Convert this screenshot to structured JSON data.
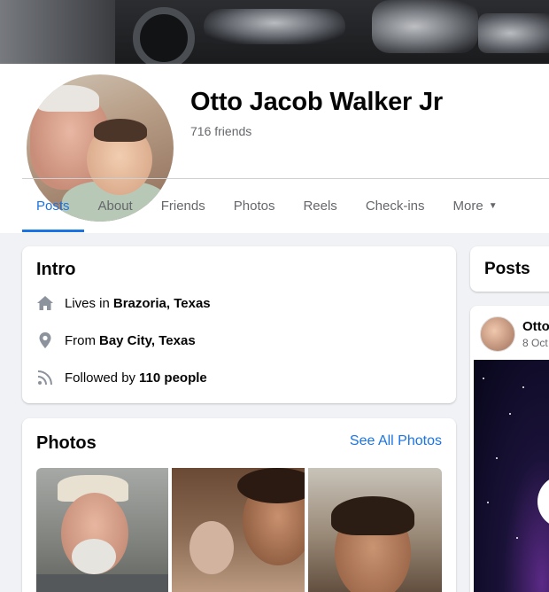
{
  "profile": {
    "name": "Otto Jacob Walker Jr",
    "friends": "716 friends"
  },
  "nav": {
    "tabs": [
      {
        "label": "Posts"
      },
      {
        "label": "About"
      },
      {
        "label": "Friends"
      },
      {
        "label": "Photos"
      },
      {
        "label": "Reels"
      },
      {
        "label": "Check-ins"
      },
      {
        "label": "More"
      }
    ],
    "more_caret": "▼"
  },
  "intro": {
    "title": "Intro",
    "lives_prefix": "Lives in",
    "lives_value": "Brazoria, Texas",
    "from_prefix": "From",
    "from_value": "Bay City, Texas",
    "followed_prefix": "Followed by",
    "followed_value": "110 people"
  },
  "photos": {
    "title": "Photos",
    "see_all": "See All Photos"
  },
  "posts": {
    "title": "Posts",
    "post_name": "Otto",
    "post_date": "8 Oct"
  },
  "icons": {
    "lives": "home-icon",
    "from": "location-pin-icon",
    "followed": "rss-feed-icon"
  },
  "colors": {
    "accent": "#1b74e4",
    "secondary_text": "#65676b",
    "background": "#f0f2f5"
  }
}
